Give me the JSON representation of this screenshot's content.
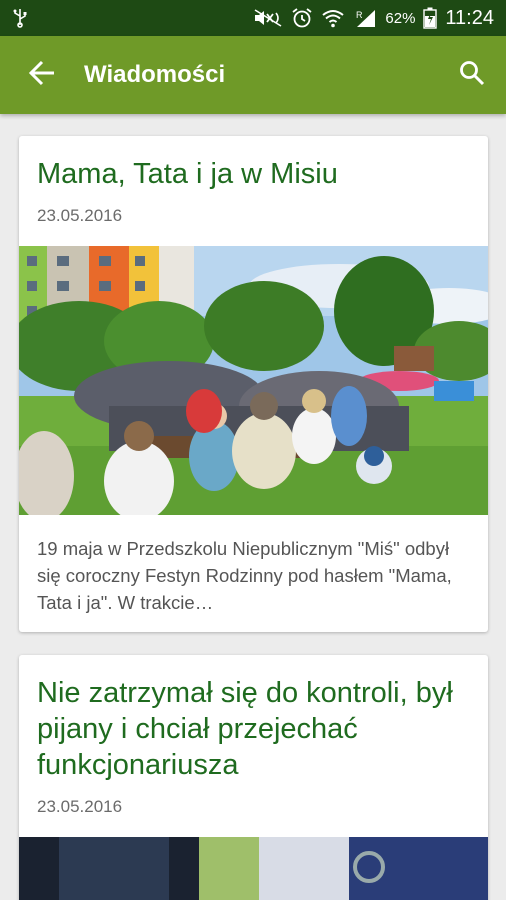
{
  "status_bar": {
    "battery_percent": "62%",
    "time": "11:24"
  },
  "app_bar": {
    "title": "Wiadomości",
    "back_icon": "arrow-back-icon",
    "search_icon": "search-icon"
  },
  "colors": {
    "status_bar": "#1e4a14",
    "app_bar": "#6f9a28",
    "headline": "#1f6b1f",
    "background": "#ececec"
  },
  "articles": [
    {
      "title": "Mama, Tata i ja w Misiu",
      "date": "23.05.2016",
      "excerpt": "19 maja w Przedszkolu Niepublicznym \"Miś\" odbył się coroczny Festyn Rodzinny pod hasłem \"Mama, Tata i ja\". W trakcie…"
    },
    {
      "title": "Nie zatrzymał się do kontroli, był pijany i chciał przejechać funkcjonariusza",
      "date": "23.05.2016"
    }
  ]
}
